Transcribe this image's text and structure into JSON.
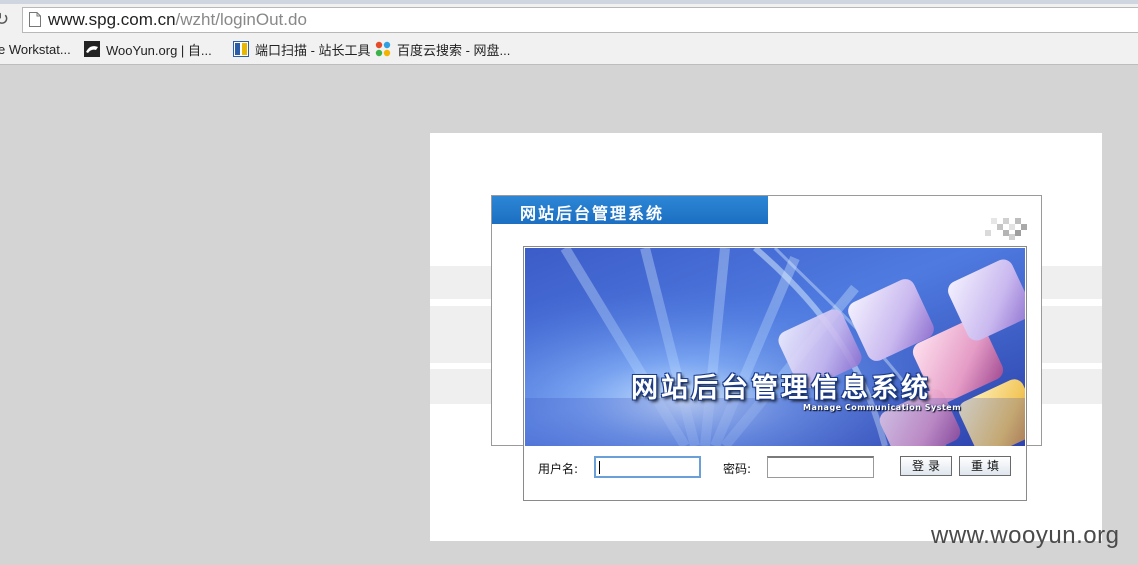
{
  "browser": {
    "url_host": "www.spg.com.cn",
    "url_path": "/wzht/loginOut.do",
    "bookmarks": [
      {
        "label": "e Workstat...",
        "icon": "none"
      },
      {
        "label": "WooYun.org | 自...",
        "icon": "wooyun-icon"
      },
      {
        "label": "端口扫描 - 站长工具",
        "icon": "chinaz-icon"
      },
      {
        "label": "百度云搜索 - 网盘...",
        "icon": "baidu-cloud-icon"
      }
    ]
  },
  "login": {
    "header_title": "网站后台管理系统",
    "banner_title": "网站后台管理信息系统",
    "banner_subtitle": "Manage Communication System",
    "username_label": "用户名:",
    "password_label": "密码:",
    "username_value": "",
    "password_value": "",
    "login_button": "登录",
    "reset_button": "重填"
  },
  "watermark": "www.wooyun.org"
}
